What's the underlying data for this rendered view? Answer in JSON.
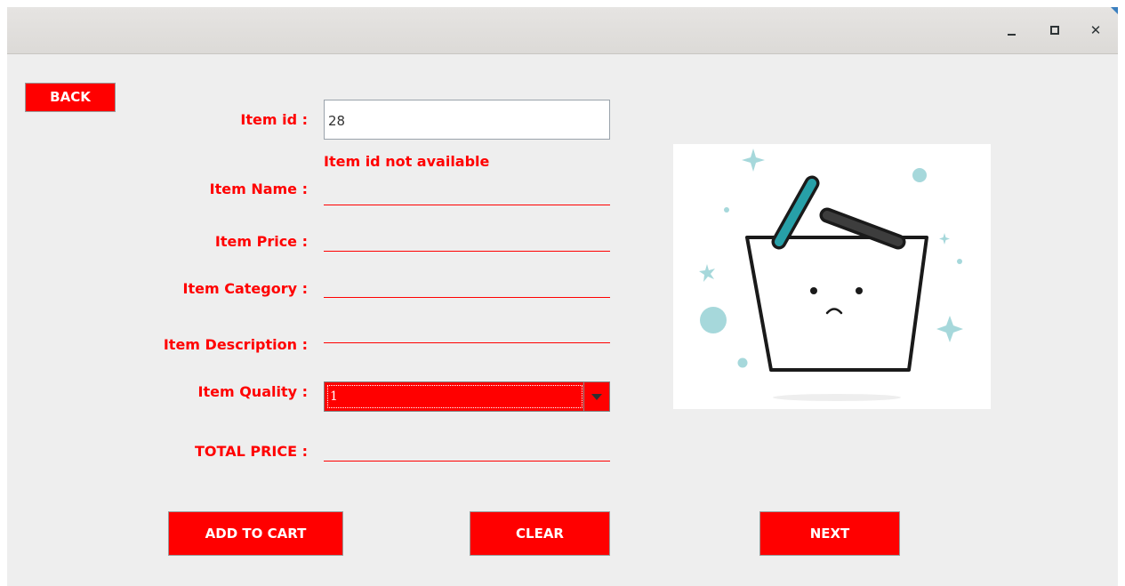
{
  "titlebar": {
    "minimize_icon": "minimize-icon",
    "maximize_icon": "maximize-icon",
    "close_icon": "close-icon",
    "close_glyph": "✕"
  },
  "buttons": {
    "back": "BACK",
    "add_to_cart": "ADD TO CART",
    "clear": "CLEAR",
    "next": "NEXT"
  },
  "form": {
    "item_id_label": "Item id :",
    "item_id_value": "28",
    "error_message": "Item id not available",
    "item_name_label": "Item Name :",
    "item_price_label": "Item Price :",
    "item_category_label": "Item Category :",
    "item_description_label": "Item Description :",
    "item_quality_label": "Item Quality :",
    "item_quality_value": "1",
    "total_price_label": "TOTAL PRICE :"
  },
  "image": {
    "icon": "empty-basket-icon"
  },
  "colors": {
    "accent": "#ff0000",
    "window_bg": "#eeeeee",
    "basket_teal_handle": "#27a0a8",
    "basket_dark_handle": "#3d3d3d",
    "sparkle": "#a6d8db"
  }
}
